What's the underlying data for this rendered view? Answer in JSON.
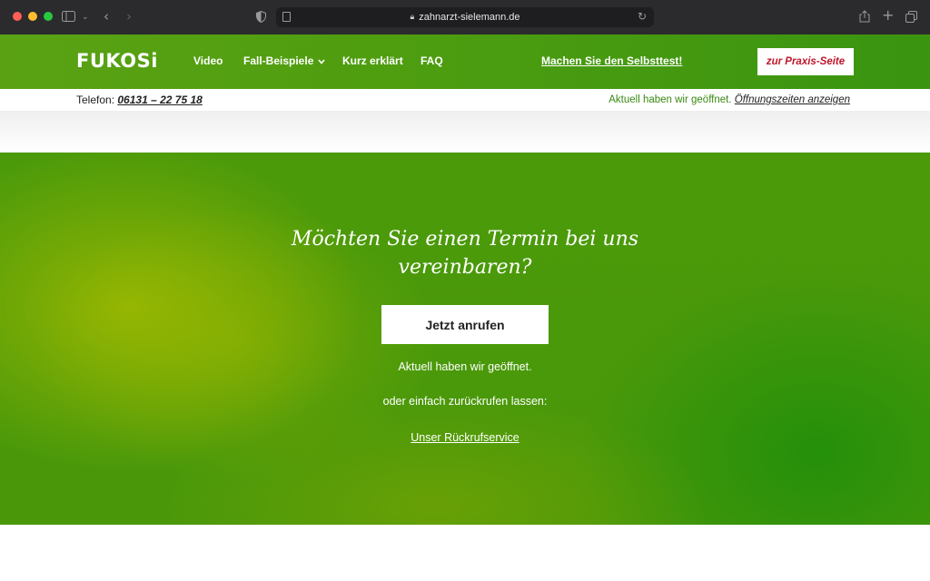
{
  "browser": {
    "url": "zahnarzt-sielemann.de",
    "icons": [
      "sidebar-icon",
      "chevron-down-icon",
      "back-icon",
      "forward-icon",
      "shield-icon",
      "page-icon",
      "lock-icon",
      "reload-icon",
      "share-icon",
      "new-tab-icon",
      "tabs-overview-icon"
    ]
  },
  "header": {
    "logo": "FUKOSi",
    "nav": [
      {
        "label": "Video"
      },
      {
        "label": "Fall-Beispiele"
      },
      {
        "label": "Kurz erklärt"
      },
      {
        "label": "FAQ"
      }
    ],
    "selftest_link": "Machen Sie den Selbsttest!",
    "praxis_button": "zur Praxis-Seite"
  },
  "info_bar": {
    "phone_label": "Telefon:",
    "phone_number": "06131 – 22 75 18",
    "open_status": "Aktuell haben wir geöffnet.",
    "hours_link": "Öffnungszeiten anzeigen"
  },
  "hero": {
    "title": "Möchten Sie einen Termin bei uns vereinbaren?",
    "call_button": "Jetzt anrufen",
    "status": "Aktuell haben wir geöffnet.",
    "or_text": "oder einfach zurückrufen lassen:",
    "callback_link": "Unser Rückrufservice"
  },
  "colors": {
    "brand_green": "#4a980a",
    "accent_red": "#c0152a",
    "status_green": "#3a8a12"
  }
}
